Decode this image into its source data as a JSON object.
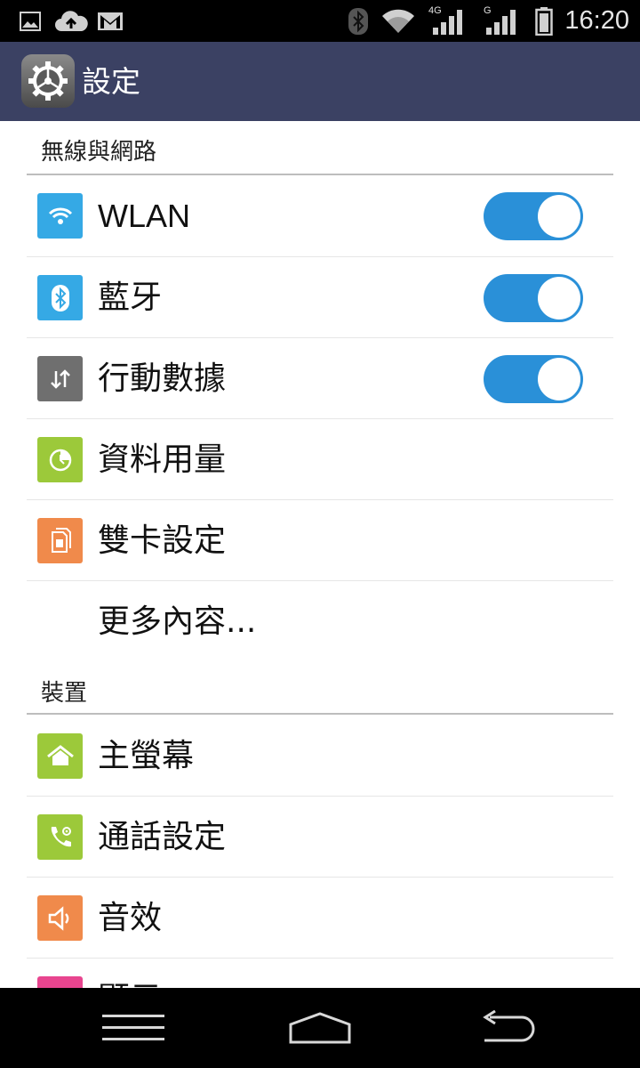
{
  "status_bar": {
    "time": "16:20",
    "network_4g_label": "4G",
    "network_g_label": "G",
    "icons": [
      "image-icon",
      "cloud-upload-icon",
      "gmail-icon",
      "bluetooth-icon",
      "wifi-icon",
      "signal-4g-icon",
      "signal-g-icon",
      "battery-icon"
    ]
  },
  "action_bar": {
    "title": "設定",
    "icon": "settings-gear-icon"
  },
  "sections": [
    {
      "header": "無線與網路",
      "items": [
        {
          "label": "WLAN",
          "icon": "wifi-icon",
          "icon_color": "#35a9e5",
          "toggle": true
        },
        {
          "label": "藍牙",
          "icon": "bluetooth-icon",
          "icon_color": "#35a9e5",
          "toggle": true
        },
        {
          "label": "行動數據",
          "icon": "mobile-data-icon",
          "icon_color": "#6f6f6f",
          "toggle": true
        },
        {
          "label": "資料用量",
          "icon": "data-usage-icon",
          "icon_color": "#9cc93a"
        },
        {
          "label": "雙卡設定",
          "icon": "sim-card-icon",
          "icon_color": "#f08a4b"
        },
        {
          "label": "更多內容..."
        }
      ]
    },
    {
      "header": "裝置",
      "items": [
        {
          "label": "主螢幕",
          "icon": "home-screen-icon",
          "icon_color": "#9cc93a"
        },
        {
          "label": "通話設定",
          "icon": "call-settings-icon",
          "icon_color": "#9cc93a"
        },
        {
          "label": "音效",
          "icon": "sound-icon",
          "icon_color": "#f08a4b"
        },
        {
          "label": "顯示",
          "icon": "display-icon",
          "icon_color": "#e8458f"
        }
      ]
    }
  ],
  "colors": {
    "action_bar": "#3b4163",
    "toggle_on": "#2a90d8",
    "status_bar": "#000000"
  },
  "nav_bar": {
    "icons": [
      "menu-icon",
      "home-icon",
      "back-icon"
    ]
  }
}
